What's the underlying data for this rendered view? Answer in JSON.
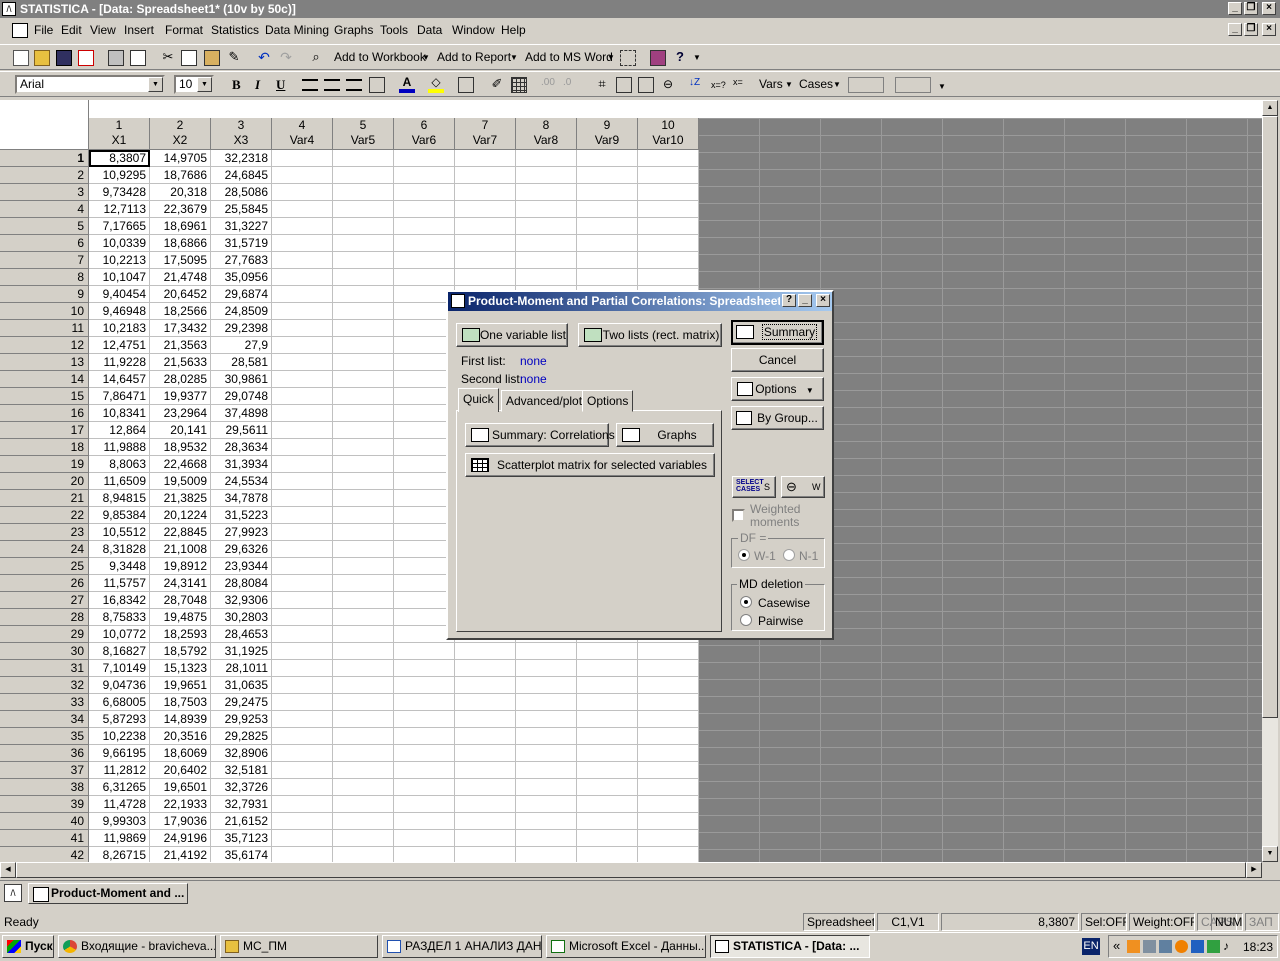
{
  "window": {
    "title": "STATISTICA - [Data: Spreadsheet1* (10v by 50c)]"
  },
  "menu": [
    "File",
    "Edit",
    "View",
    "Insert",
    "Format",
    "Statistics",
    "Data Mining",
    "Graphs",
    "Tools",
    "Data",
    "Window",
    "Help"
  ],
  "toolbar1": {
    "add_workbook": "Add to Workbook",
    "add_report": "Add to Report",
    "add_msword": "Add to MS Word"
  },
  "toolbar2": {
    "font": "Arial",
    "size": "10",
    "bold": "B",
    "italic": "I",
    "underline": "U",
    "vars": "Vars",
    "cases": "Cases",
    "xs_label": "x=?"
  },
  "columns": [
    {
      "num": "1",
      "name": "X1"
    },
    {
      "num": "2",
      "name": "X2"
    },
    {
      "num": "3",
      "name": "X3"
    },
    {
      "num": "4",
      "name": "Var4"
    },
    {
      "num": "5",
      "name": "Var5"
    },
    {
      "num": "6",
      "name": "Var6"
    },
    {
      "num": "7",
      "name": "Var7"
    },
    {
      "num": "8",
      "name": "Var8"
    },
    {
      "num": "9",
      "name": "Var9"
    },
    {
      "num": "10",
      "name": "Var10"
    }
  ],
  "rows": [
    [
      "1",
      "8,3807",
      "14,9705",
      "32,2318"
    ],
    [
      "2",
      "10,9295",
      "18,7686",
      "24,6845"
    ],
    [
      "3",
      "9,73428",
      "20,318",
      "28,5086"
    ],
    [
      "4",
      "12,7113",
      "22,3679",
      "25,5845"
    ],
    [
      "5",
      "7,17665",
      "18,6961",
      "31,3227"
    ],
    [
      "6",
      "10,0339",
      "18,6866",
      "31,5719"
    ],
    [
      "7",
      "10,2213",
      "17,5095",
      "27,7683"
    ],
    [
      "8",
      "10,1047",
      "21,4748",
      "35,0956"
    ],
    [
      "9",
      "9,40454",
      "20,6452",
      "29,6874"
    ],
    [
      "10",
      "9,46948",
      "18,2566",
      "24,8509"
    ],
    [
      "11",
      "10,2183",
      "17,3432",
      "29,2398"
    ],
    [
      "12",
      "12,4751",
      "21,3563",
      "27,9"
    ],
    [
      "13",
      "11,9228",
      "21,5633",
      "28,581"
    ],
    [
      "14",
      "14,6457",
      "28,0285",
      "30,9861"
    ],
    [
      "15",
      "7,86471",
      "19,9377",
      "29,0748"
    ],
    [
      "16",
      "10,8341",
      "23,2964",
      "37,4898"
    ],
    [
      "17",
      "12,864",
      "20,141",
      "29,5611"
    ],
    [
      "18",
      "11,9888",
      "18,9532",
      "28,3634"
    ],
    [
      "19",
      "8,8063",
      "22,4668",
      "31,3934"
    ],
    [
      "20",
      "11,6509",
      "19,5009",
      "24,5534"
    ],
    [
      "21",
      "8,94815",
      "21,3825",
      "34,7878"
    ],
    [
      "22",
      "9,85384",
      "20,1224",
      "31,5223"
    ],
    [
      "23",
      "10,5512",
      "22,8845",
      "27,9923"
    ],
    [
      "24",
      "8,31828",
      "21,1008",
      "29,6326"
    ],
    [
      "25",
      "9,3448",
      "19,8912",
      "23,9344"
    ],
    [
      "26",
      "11,5757",
      "24,3141",
      "28,8084"
    ],
    [
      "27",
      "16,8342",
      "28,7048",
      "32,9306"
    ],
    [
      "28",
      "8,75833",
      "19,4875",
      "30,2803"
    ],
    [
      "29",
      "10,0772",
      "18,2593",
      "28,4653"
    ],
    [
      "30",
      "8,16827",
      "18,5792",
      "31,1925"
    ],
    [
      "31",
      "7,10149",
      "15,1323",
      "28,1011"
    ],
    [
      "32",
      "9,04736",
      "19,9651",
      "31,0635"
    ],
    [
      "33",
      "6,68005",
      "18,7503",
      "29,2475"
    ],
    [
      "34",
      "5,87293",
      "14,8939",
      "29,9253"
    ],
    [
      "35",
      "10,2238",
      "20,3516",
      "29,2825"
    ],
    [
      "36",
      "9,66195",
      "18,6069",
      "32,8906"
    ],
    [
      "37",
      "11,2812",
      "20,6402",
      "32,5181"
    ],
    [
      "38",
      "6,31265",
      "19,6501",
      "32,3726"
    ],
    [
      "39",
      "11,4728",
      "22,1933",
      "32,7931"
    ],
    [
      "40",
      "9,99303",
      "17,9036",
      "21,6152"
    ],
    [
      "41",
      "11,9869",
      "24,9196",
      "35,7123"
    ],
    [
      "42",
      "8,26715",
      "21,4192",
      "35,6174"
    ]
  ],
  "dialog": {
    "title": "Product-Moment and Partial Correlations: Spreadsheet1",
    "one_var": "One variable list",
    "two_lists": "Two lists (rect. matrix)",
    "first_list_label": "First list:",
    "first_list_value": "none",
    "second_list_label": "Second list:",
    "second_list_value": "none",
    "tabs": [
      "Quick",
      "Advanced/plot",
      "Options"
    ],
    "summary_corr": "Summary:  Correlations",
    "graphs": "Graphs",
    "scatter": "Scatterplot matrix for selected variables",
    "summary": "Summary",
    "cancel": "Cancel",
    "options": "Options",
    "bygroup": "By Group...",
    "select_cases": "SELECT CASES",
    "s_label": "S",
    "w_label": "W",
    "weighted": "Weighted moments",
    "df_label": "DF =",
    "df_w1": "W-1",
    "df_n1": "N-1",
    "md_deletion": "MD deletion",
    "casewise": "Casewise",
    "pairwise": "Pairwise"
  },
  "workbook_tab": "Product-Moment and ...",
  "status": {
    "ready": "Ready",
    "sheet": "Spreadsheet1",
    "cell": "C1,V1",
    "value": "8,3807",
    "sel": "Sel:OFF",
    "weight": "Weight:OFF",
    "caps": "CAPS",
    "num": "NUM",
    "zap": "ЗАП"
  },
  "taskbar": {
    "start": "Пуск",
    "items": [
      "Входящие - bravicheva...",
      "МС_ПМ",
      "РАЗДЕЛ 1 АНАЛИЗ ДАН...",
      "Microsoft Excel - Данны...",
      "STATISTICA - [Data: ..."
    ],
    "lang": "EN",
    "clock": "18:23"
  }
}
